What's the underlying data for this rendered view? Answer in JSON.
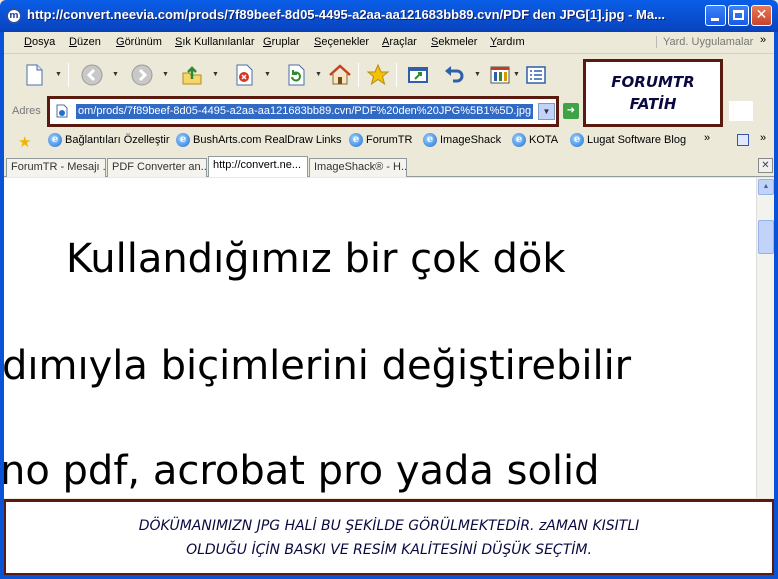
{
  "window": {
    "title": "http://convert.neevia.com/prods/7f89beef-8d05-4495-a2aa-aa121683bb89.cvn/PDF den JPG[1].jpg - Ma...",
    "app_icon": "m"
  },
  "menubar": {
    "items": [
      "Dosya",
      "Düzen",
      "Görünüm",
      "Sık Kullanılanlar",
      "Gruplar",
      "Seçenekler",
      "Araçlar",
      "Sekmeler",
      "Yardım"
    ],
    "addon_text": "Yard. Uygulamalar",
    "chevron": "»"
  },
  "toolbar": {
    "buttons": [
      "new-page-icon",
      "back-icon",
      "forward-icon",
      "up-icon",
      "stop-icon",
      "refresh-icon",
      "home-icon",
      "favorites-icon",
      "fullscreen-icon",
      "undo-icon",
      "tools-icon",
      "list-icon"
    ]
  },
  "callout_top": {
    "line1": "FORUMTR",
    "line2": "FATİH"
  },
  "address": {
    "label": "Adres",
    "url": "om/prods/7f89beef-8d05-4495-a2aa-aa121683bb89.cvn/PDF%20den%20JPG%5B1%5D.jpg"
  },
  "links": {
    "items": [
      "Bağlantıları Özelleştir",
      "BushArts.com RealDraw Links",
      "ForumTR",
      "ImageShack",
      "KOTA",
      "Lugat Software Blog"
    ],
    "chevron": "»"
  },
  "tabs": [
    {
      "label": "ForumTR - Mesajı ...",
      "active": false
    },
    {
      "label": "PDF Converter an...",
      "active": false
    },
    {
      "label": "http://convert.ne...",
      "active": true
    },
    {
      "label": "ImageShack® - H...",
      "active": false
    }
  ],
  "document": {
    "lines": [
      "Kullandığımız   bir   çok   dök",
      "dımıyla  biçimlerini  değiştirebilir",
      "no pdf, acrobat pro yada solid"
    ]
  },
  "callout_bottom": {
    "line1": "DÖKÜMANIMIZN JPG HALİ BU ŞEKİLDE GÖRÜLMEKTEDİR. zAMAN KISITLI",
    "line2": "OLDUĞU İÇİN BASKI VE RESİM KALİTESİNİ DÜŞÜK SEÇTİM."
  },
  "colors": {
    "title_bar": "#0b53d6",
    "selection": "#316ac5",
    "callout_border": "#5a1a10",
    "callout_text": "#0a0a40"
  }
}
